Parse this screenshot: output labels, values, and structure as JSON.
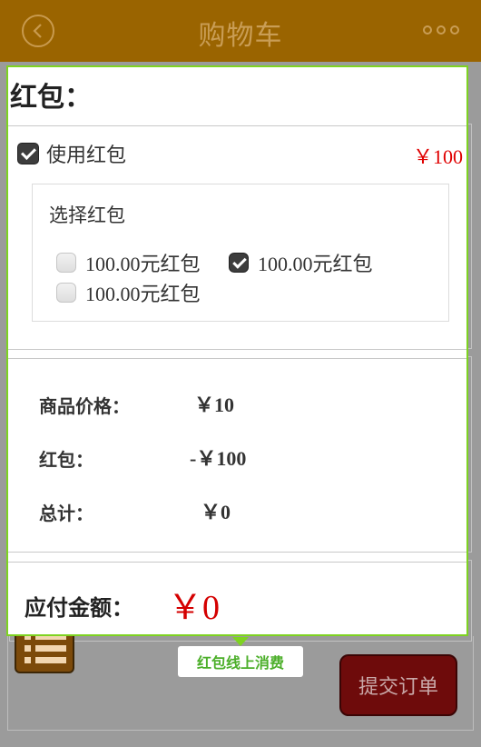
{
  "header": {
    "title": "购物车"
  },
  "redpacket": {
    "section_title": "红包：",
    "use_label": "使用红包",
    "amount": "￥100",
    "choose_title": "选择红包",
    "options": [
      {
        "label": "100.00元红包",
        "checked": false
      },
      {
        "label": "100.00元红包",
        "checked": true
      },
      {
        "label": "100.00元红包",
        "checked": false
      }
    ]
  },
  "summary": {
    "rows": [
      {
        "label": "商品价格：",
        "value": "￥10"
      },
      {
        "label": "红包：",
        "value": "-￥100"
      },
      {
        "label": "总计：",
        "value": "￥0"
      }
    ]
  },
  "payment": {
    "label": "应付金额：",
    "value": "￥0"
  },
  "footer": {
    "submit_label": "提交订单"
  },
  "tooltip": {
    "text": "红包线上消费"
  },
  "colors": {
    "header": "#9a6400",
    "highlight": "#7ed321",
    "price_red": "#d40000",
    "submit": "#6e0b0b"
  }
}
